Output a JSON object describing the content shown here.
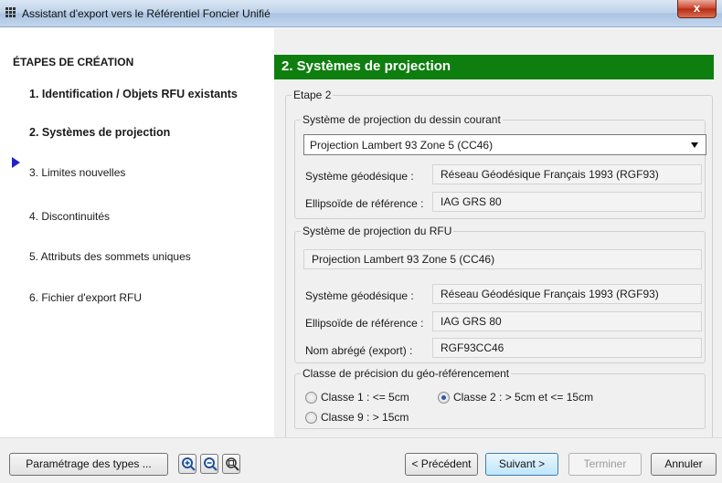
{
  "window": {
    "title": "Assistant d'export vers le Référentiel Foncier Unifié",
    "close_label": "x"
  },
  "left": {
    "heading": "ÉTAPES DE CRÉATION",
    "steps": [
      {
        "label": "1. Identification / Objets RFU existants",
        "state": "done"
      },
      {
        "label": "2. Systèmes de projection",
        "state": "current"
      },
      {
        "label": "3. Limites nouvelles",
        "state": "pending"
      },
      {
        "label": "4. Discontinuités",
        "state": "pending"
      },
      {
        "label": "5. Attributs des sommets uniques",
        "state": "pending"
      },
      {
        "label": "6. Fichier d'export RFU",
        "state": "pending"
      }
    ]
  },
  "right": {
    "header": "2. Systèmes de projection",
    "header_color": "#0e7f0e",
    "etape_legend": "Etape 2",
    "current_drawing": {
      "legend": "Système de projection du dessin courant",
      "selected_projection": "Projection Lambert 93 Zone 5 (CC46)",
      "geodetic_label": "Système géodésique :",
      "geodetic_value": "Réseau Géodésique Français 1993 (RGF93)",
      "ellipsoid_label": "Ellipsoïde de référence :",
      "ellipsoid_value": "IAG GRS 80"
    },
    "rfu": {
      "legend": "Système de projection du RFU",
      "projection": "Projection Lambert 93 Zone 5 (CC46)",
      "geodetic_label": "Système géodésique :",
      "geodetic_value": "Réseau Géodésique Français 1993 (RGF93)",
      "ellipsoid_label": "Ellipsoïde de référence :",
      "ellipsoid_value": "IAG GRS 80",
      "short_name_label": "Nom abrégé (export) :",
      "short_name_value": "RGF93CC46"
    },
    "precision": {
      "legend": "Classe de précision du géo-référencement",
      "options": [
        {
          "label": "Classe 1 : <= 5cm",
          "checked": false
        },
        {
          "label": "Classe 2 : > 5cm et <= 15cm",
          "checked": true
        },
        {
          "label": "Classe 9 : > 15cm",
          "checked": false
        }
      ]
    }
  },
  "bottom": {
    "params_button": "Paramétrage des types ...",
    "zoom_in": "zoom-in-icon",
    "zoom_out": "zoom-out-icon",
    "zoom_fit": "zoom-fit-icon",
    "previous": "< Précédent",
    "next": "Suivant >",
    "finish": "Terminer",
    "cancel": "Annuler"
  }
}
